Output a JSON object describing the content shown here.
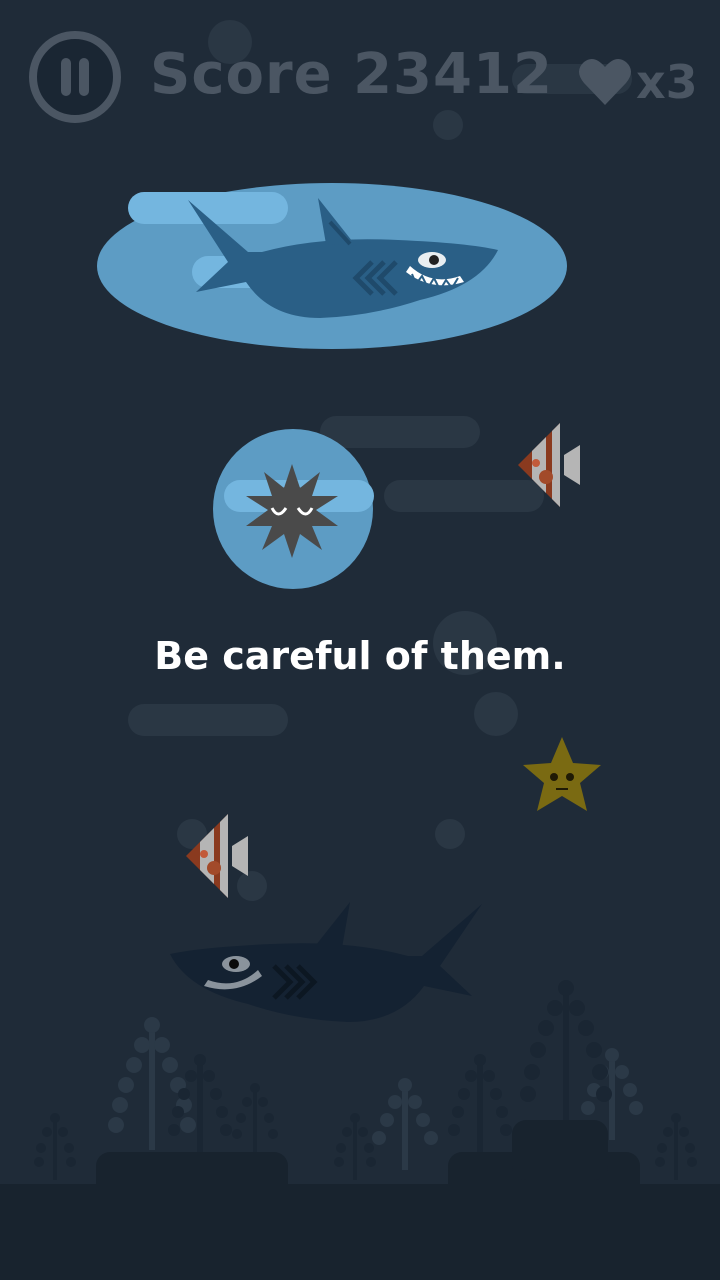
{
  "hud": {
    "score_text": "Score 23412",
    "lives_text": "x3",
    "pause_icon": "pause-icon",
    "heart_icon": "heart-icon"
  },
  "tutorial": {
    "message": "Be careful of them."
  },
  "colors": {
    "background": "#1f2b38",
    "highlight_bubble": "#5d9cc4",
    "hud_text": "#4b5663",
    "shark_body": "#2a5f86",
    "urchin": "#4a4a4a",
    "starfish": "#7a6a12",
    "angelfish_stripe": "#8a3a1f"
  },
  "entities": [
    "shark",
    "urchin",
    "angelfish",
    "angelfish",
    "starfish",
    "shark"
  ]
}
